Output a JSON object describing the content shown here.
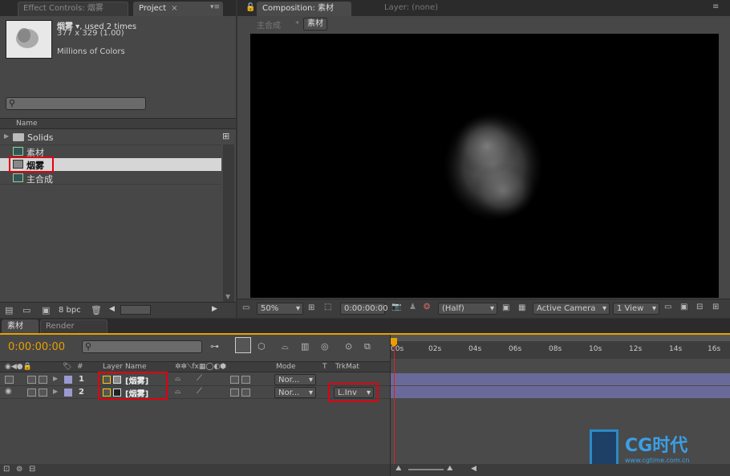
{
  "left_tabs": {
    "effect_controls": "Effect Controls: 烟雾",
    "project": "Project"
  },
  "project": {
    "item_name": "烟雾",
    "item_usage": ", used 2 times",
    "item_dims": "377 x 329 (1.00)",
    "item_colors": "Millions of Colors",
    "search_placeholder": "",
    "name_header": "Name",
    "items": [
      {
        "label": "Solids",
        "type": "folder"
      },
      {
        "label": "素材",
        "type": "comp"
      },
      {
        "label": "烟雾",
        "type": "footage",
        "selected": true
      },
      {
        "label": "主合成",
        "type": "comp"
      }
    ],
    "bpc": "8 bpc"
  },
  "comp_tabs": {
    "composition": "Composition: 素材",
    "layer": "Layer: (none)"
  },
  "comp_breadcrumb": {
    "main": "主合成",
    "current": "素材"
  },
  "viewer_bar": {
    "zoom": "50%",
    "timecode": "0:00:00:00",
    "resolution": "(Half)",
    "camera": "Active Camera",
    "views": "1 View"
  },
  "timeline_tabs": {
    "comp": "素材",
    "render_queue": "Render Queue"
  },
  "timeline": {
    "current_time": "0:00:00:00",
    "search_placeholder": "",
    "col_num": "#",
    "col_layer": "Layer Name",
    "col_mode": "Mode",
    "col_t": "T",
    "col_trkmat": "TrkMat",
    "layers": [
      {
        "index": "1",
        "name": "[烟雾]",
        "mode": "Nor...",
        "trkmat": ""
      },
      {
        "index": "2",
        "name": "[烟雾]",
        "mode": "Nor...",
        "trkmat": "L.Inv"
      }
    ],
    "ruler": [
      "00s",
      "02s",
      "04s",
      "06s",
      "08s",
      "10s",
      "12s",
      "14s",
      "16s"
    ]
  },
  "watermark": {
    "brand": "CG时代",
    "url": "www.cgtime.com.cn"
  },
  "colors": {
    "accent_orange": "#e8a000",
    "red_highlight": "#e00010",
    "layer_bar": "#6a6a9a",
    "playhead": "#e02020"
  }
}
